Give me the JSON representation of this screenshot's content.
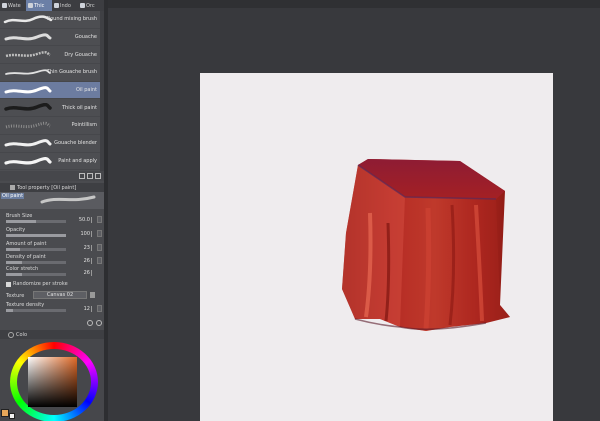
{
  "tabs": [
    {
      "label": "Wate"
    },
    {
      "label": "Thic"
    },
    {
      "label": "Indo"
    },
    {
      "label": "Orc"
    }
  ],
  "brushes": [
    {
      "name": "Round mixing brush"
    },
    {
      "name": "Gouache"
    },
    {
      "name": "Dry Gouache"
    },
    {
      "name": "Thin Gouache brush"
    },
    {
      "name": "Oil paint"
    },
    {
      "name": "Thick oil paint"
    },
    {
      "name": "Pointillism"
    },
    {
      "name": "Gouache blender"
    },
    {
      "name": "Paint and apply"
    }
  ],
  "selected_brush": "Oil paint",
  "tool_property": {
    "title": "Tool property [Oil paint]",
    "preview_label": "Oil paint",
    "props": [
      {
        "label": "Brush Size",
        "value": "50.0",
        "fill": 0.5
      },
      {
        "label": "Opacity",
        "value": "100",
        "fill": 1.0
      },
      {
        "label": "Amount of paint",
        "value": "23",
        "fill": 0.23
      },
      {
        "label": "Density of paint",
        "value": "26",
        "fill": 0.26
      },
      {
        "label": "Color stretch",
        "value": "26",
        "fill": 0.26
      }
    ],
    "randomize_label": "Randomize per stroke",
    "randomize_checked": true,
    "texture_label": "Texture",
    "texture_value": "Canvas 02",
    "texture_density": {
      "label": "Texture density",
      "value": "12",
      "fill": 0.12
    }
  },
  "color_panel": {
    "title": "Colo",
    "main_color": "#e8a85a",
    "sub_color": "#f2f2f2"
  },
  "colors": {
    "panel_bg": "#4a4b4f",
    "selected": "#6c7ca0",
    "workspace": "#38393d",
    "paper": "#efecee",
    "cloth": "#b42a20"
  }
}
